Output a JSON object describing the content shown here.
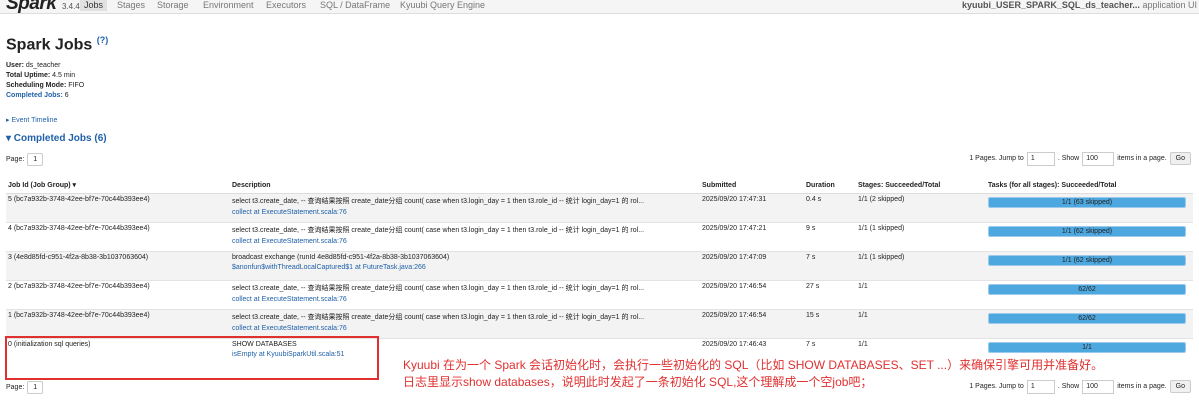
{
  "navbar": {
    "brand": "Spark",
    "version": "3.4.4",
    "tabs": [
      "Jobs",
      "Stages",
      "Storage",
      "Environment",
      "Executors",
      "SQL / DataFrame",
      "Kyuubi Query Engine"
    ],
    "app_name": "kyuubi_USER_SPARK_SQL_ds_teacher...",
    "app_suffix": "application UI"
  },
  "page": {
    "title": "Spark Jobs",
    "help": "(?)"
  },
  "summary": {
    "user_label": "User:",
    "user": "ds_teacher",
    "uptime_label": "Total Uptime:",
    "uptime": "4.5 min",
    "mode_label": "Scheduling Mode:",
    "mode": "FIFO",
    "completed_label": "Completed Jobs:",
    "completed": "6"
  },
  "event_timeline": "▸ Event Timeline",
  "section_title": "▾ Completed Jobs (6)",
  "pager": {
    "page_label": "Page:",
    "page": "1",
    "pages_text": "1 Pages. Jump to",
    "jump": "1",
    "show_label": ". Show",
    "show": "100",
    "items_text": "items in a page.",
    "go": "Go"
  },
  "table": {
    "headers": [
      "Job Id (Job Group) ▾",
      "Description",
      "Submitted",
      "Duration",
      "Stages: Succeeded/Total",
      "Tasks (for all stages): Succeeded/Total"
    ],
    "rows": [
      {
        "id": "5 (bc7a932b-3748-42ee-bf7e-70c44b393ee4)",
        "desc": "select t3.create_date, -- 查询结果按照 create_date分组 count( case when t3.login_day = 1 then t3.role_id -- 统计 login_day=1 的 rol...",
        "link": "collect at ExecuteStatement.scala:76",
        "submitted": "2025/09/20 17:47:31",
        "duration": "0.4 s",
        "stages": "1/1 (2 skipped)",
        "tasks": "1/1 (63 skipped)",
        "progress": 1
      },
      {
        "id": "4 (bc7a932b-3748-42ee-bf7e-70c44b393ee4)",
        "desc": "select t3.create_date, -- 查询结果按照 create_date分组 count( case when t3.login_day = 1 then t3.role_id -- 统计 login_day=1 的 rol...",
        "link": "collect at ExecuteStatement.scala:76",
        "submitted": "2025/09/20 17:47:21",
        "duration": "9 s",
        "stages": "1/1 (1 skipped)",
        "tasks": "1/1 (62 skipped)",
        "progress": 1
      },
      {
        "id": "3 (4e8d85fd-c951-4f2a-8b38-3b1037063604)",
        "desc": "broadcast exchange (runId 4e8d85fd-c951-4f2a-8b38-3b1037063604)",
        "link": "$anonfun$withThreadLocalCaptured$1 at FutureTask.java:266",
        "submitted": "2025/09/20 17:47:09",
        "duration": "7 s",
        "stages": "1/1 (1 skipped)",
        "tasks": "1/1 (62 skipped)",
        "progress": 1
      },
      {
        "id": "2 (bc7a932b-3748-42ee-bf7e-70c44b393ee4)",
        "desc": "select t3.create_date, -- 查询结果按照 create_date分组 count( case when t3.login_day = 1 then t3.role_id -- 统计 login_day=1 的 rol...",
        "link": "collect at ExecuteStatement.scala:76",
        "submitted": "2025/09/20 17:46:54",
        "duration": "27 s",
        "stages": "1/1",
        "tasks": "62/62",
        "progress": 1
      },
      {
        "id": "1 (bc7a932b-3748-42ee-bf7e-70c44b393ee4)",
        "desc": "select t3.create_date, -- 查询结果按照 create_date分组 count( case when t3.login_day = 1 then t3.role_id -- 统计 login_day=1 的 rol...",
        "link": "collect at ExecuteStatement.scala:76",
        "submitted": "2025/09/20 17:46:54",
        "duration": "15 s",
        "stages": "1/1",
        "tasks": "62/62",
        "progress": 1
      },
      {
        "id": "0 (initialization sql queries)",
        "desc": "SHOW DATABASES",
        "link": "isEmpty at KyuubiSparkUtil.scala:51",
        "submitted": "2025/09/20 17:46:43",
        "duration": "7 s",
        "stages": "1/1",
        "tasks": "1/1",
        "progress": 1
      }
    ]
  },
  "annotation": {
    "line1": "Kyuubi 在为一个 Spark 会话初始化时，会执行一些初始化的 SQL（比如 SHOW DATABASES、SET ...）来确保引擎可用并准备好。",
    "line2": "日志里显示show databases，说明此时发起了一条初始化 SQL,这个理解成一个空job吧；"
  },
  "colors": {
    "accent": "#1f60a8",
    "progress": "#4ea8e0",
    "annotation": "#e03030"
  }
}
